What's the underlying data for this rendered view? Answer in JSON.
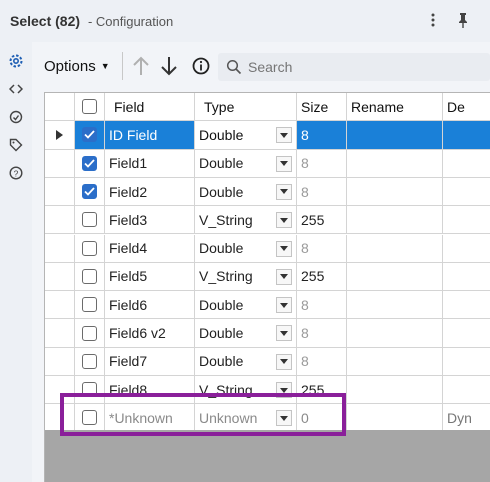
{
  "header": {
    "tool_name": "Select (82)",
    "subtitle": "- Configuration"
  },
  "toolbar": {
    "options_label": "Options",
    "search_placeholder": "Search"
  },
  "columns": {
    "field": "Field",
    "type": "Type",
    "size": "Size",
    "rename": "Rename",
    "description": "De"
  },
  "rows": [
    {
      "field": "ID Field",
      "type": "Double",
      "size": "8",
      "checked": true
    },
    {
      "field": "Field1",
      "type": "Double",
      "size": "8",
      "checked": true
    },
    {
      "field": "Field2",
      "type": "Double",
      "size": "8",
      "checked": true
    },
    {
      "field": "Field3",
      "type": "V_String",
      "size": "255",
      "checked": false
    },
    {
      "field": "Field4",
      "type": "Double",
      "size": "8",
      "checked": false
    },
    {
      "field": "Field5",
      "type": "V_String",
      "size": "255",
      "checked": false
    },
    {
      "field": "Field6",
      "type": "Double",
      "size": "8",
      "checked": false
    },
    {
      "field": "Field6 v2",
      "type": "Double",
      "size": "8",
      "checked": false
    },
    {
      "field": "Field7",
      "type": "Double",
      "size": "8",
      "checked": false
    },
    {
      "field": "Field8",
      "type": "V_String",
      "size": "255",
      "checked": false
    },
    {
      "field": "*Unknown",
      "type": "Unknown",
      "size": "0",
      "description": "Dyn",
      "checked": false
    }
  ],
  "colors": {
    "selection": "#1a80d8",
    "checkbox_on": "#2b6ec9",
    "highlight": "#8a1f9a"
  }
}
